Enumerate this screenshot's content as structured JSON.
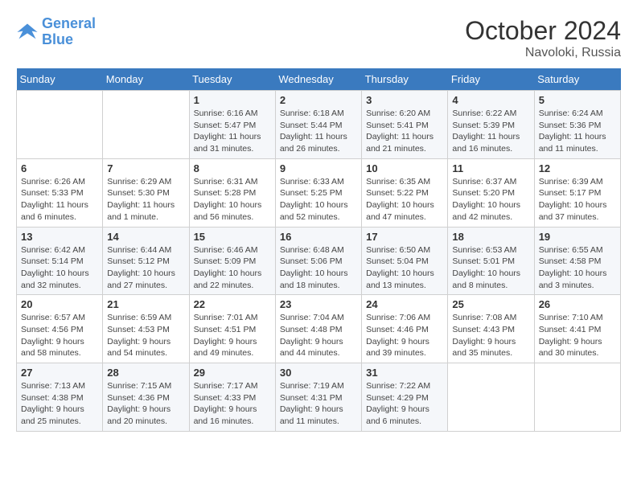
{
  "logo": {
    "line1": "General",
    "line2": "Blue"
  },
  "title": "October 2024",
  "location": "Navoloki, Russia",
  "days_header": [
    "Sunday",
    "Monday",
    "Tuesday",
    "Wednesday",
    "Thursday",
    "Friday",
    "Saturday"
  ],
  "weeks": [
    [
      {
        "day": "",
        "info": ""
      },
      {
        "day": "",
        "info": ""
      },
      {
        "day": "1",
        "info": "Sunrise: 6:16 AM\nSunset: 5:47 PM\nDaylight: 11 hours and 31 minutes."
      },
      {
        "day": "2",
        "info": "Sunrise: 6:18 AM\nSunset: 5:44 PM\nDaylight: 11 hours and 26 minutes."
      },
      {
        "day": "3",
        "info": "Sunrise: 6:20 AM\nSunset: 5:41 PM\nDaylight: 11 hours and 21 minutes."
      },
      {
        "day": "4",
        "info": "Sunrise: 6:22 AM\nSunset: 5:39 PM\nDaylight: 11 hours and 16 minutes."
      },
      {
        "day": "5",
        "info": "Sunrise: 6:24 AM\nSunset: 5:36 PM\nDaylight: 11 hours and 11 minutes."
      }
    ],
    [
      {
        "day": "6",
        "info": "Sunrise: 6:26 AM\nSunset: 5:33 PM\nDaylight: 11 hours and 6 minutes."
      },
      {
        "day": "7",
        "info": "Sunrise: 6:29 AM\nSunset: 5:30 PM\nDaylight: 11 hours and 1 minute."
      },
      {
        "day": "8",
        "info": "Sunrise: 6:31 AM\nSunset: 5:28 PM\nDaylight: 10 hours and 56 minutes."
      },
      {
        "day": "9",
        "info": "Sunrise: 6:33 AM\nSunset: 5:25 PM\nDaylight: 10 hours and 52 minutes."
      },
      {
        "day": "10",
        "info": "Sunrise: 6:35 AM\nSunset: 5:22 PM\nDaylight: 10 hours and 47 minutes."
      },
      {
        "day": "11",
        "info": "Sunrise: 6:37 AM\nSunset: 5:20 PM\nDaylight: 10 hours and 42 minutes."
      },
      {
        "day": "12",
        "info": "Sunrise: 6:39 AM\nSunset: 5:17 PM\nDaylight: 10 hours and 37 minutes."
      }
    ],
    [
      {
        "day": "13",
        "info": "Sunrise: 6:42 AM\nSunset: 5:14 PM\nDaylight: 10 hours and 32 minutes."
      },
      {
        "day": "14",
        "info": "Sunrise: 6:44 AM\nSunset: 5:12 PM\nDaylight: 10 hours and 27 minutes."
      },
      {
        "day": "15",
        "info": "Sunrise: 6:46 AM\nSunset: 5:09 PM\nDaylight: 10 hours and 22 minutes."
      },
      {
        "day": "16",
        "info": "Sunrise: 6:48 AM\nSunset: 5:06 PM\nDaylight: 10 hours and 18 minutes."
      },
      {
        "day": "17",
        "info": "Sunrise: 6:50 AM\nSunset: 5:04 PM\nDaylight: 10 hours and 13 minutes."
      },
      {
        "day": "18",
        "info": "Sunrise: 6:53 AM\nSunset: 5:01 PM\nDaylight: 10 hours and 8 minutes."
      },
      {
        "day": "19",
        "info": "Sunrise: 6:55 AM\nSunset: 4:58 PM\nDaylight: 10 hours and 3 minutes."
      }
    ],
    [
      {
        "day": "20",
        "info": "Sunrise: 6:57 AM\nSunset: 4:56 PM\nDaylight: 9 hours and 58 minutes."
      },
      {
        "day": "21",
        "info": "Sunrise: 6:59 AM\nSunset: 4:53 PM\nDaylight: 9 hours and 54 minutes."
      },
      {
        "day": "22",
        "info": "Sunrise: 7:01 AM\nSunset: 4:51 PM\nDaylight: 9 hours and 49 minutes."
      },
      {
        "day": "23",
        "info": "Sunrise: 7:04 AM\nSunset: 4:48 PM\nDaylight: 9 hours and 44 minutes."
      },
      {
        "day": "24",
        "info": "Sunrise: 7:06 AM\nSunset: 4:46 PM\nDaylight: 9 hours and 39 minutes."
      },
      {
        "day": "25",
        "info": "Sunrise: 7:08 AM\nSunset: 4:43 PM\nDaylight: 9 hours and 35 minutes."
      },
      {
        "day": "26",
        "info": "Sunrise: 7:10 AM\nSunset: 4:41 PM\nDaylight: 9 hours and 30 minutes."
      }
    ],
    [
      {
        "day": "27",
        "info": "Sunrise: 7:13 AM\nSunset: 4:38 PM\nDaylight: 9 hours and 25 minutes."
      },
      {
        "day": "28",
        "info": "Sunrise: 7:15 AM\nSunset: 4:36 PM\nDaylight: 9 hours and 20 minutes."
      },
      {
        "day": "29",
        "info": "Sunrise: 7:17 AM\nSunset: 4:33 PM\nDaylight: 9 hours and 16 minutes."
      },
      {
        "day": "30",
        "info": "Sunrise: 7:19 AM\nSunset: 4:31 PM\nDaylight: 9 hours and 11 minutes."
      },
      {
        "day": "31",
        "info": "Sunrise: 7:22 AM\nSunset: 4:29 PM\nDaylight: 9 hours and 6 minutes."
      },
      {
        "day": "",
        "info": ""
      },
      {
        "day": "",
        "info": ""
      }
    ]
  ]
}
